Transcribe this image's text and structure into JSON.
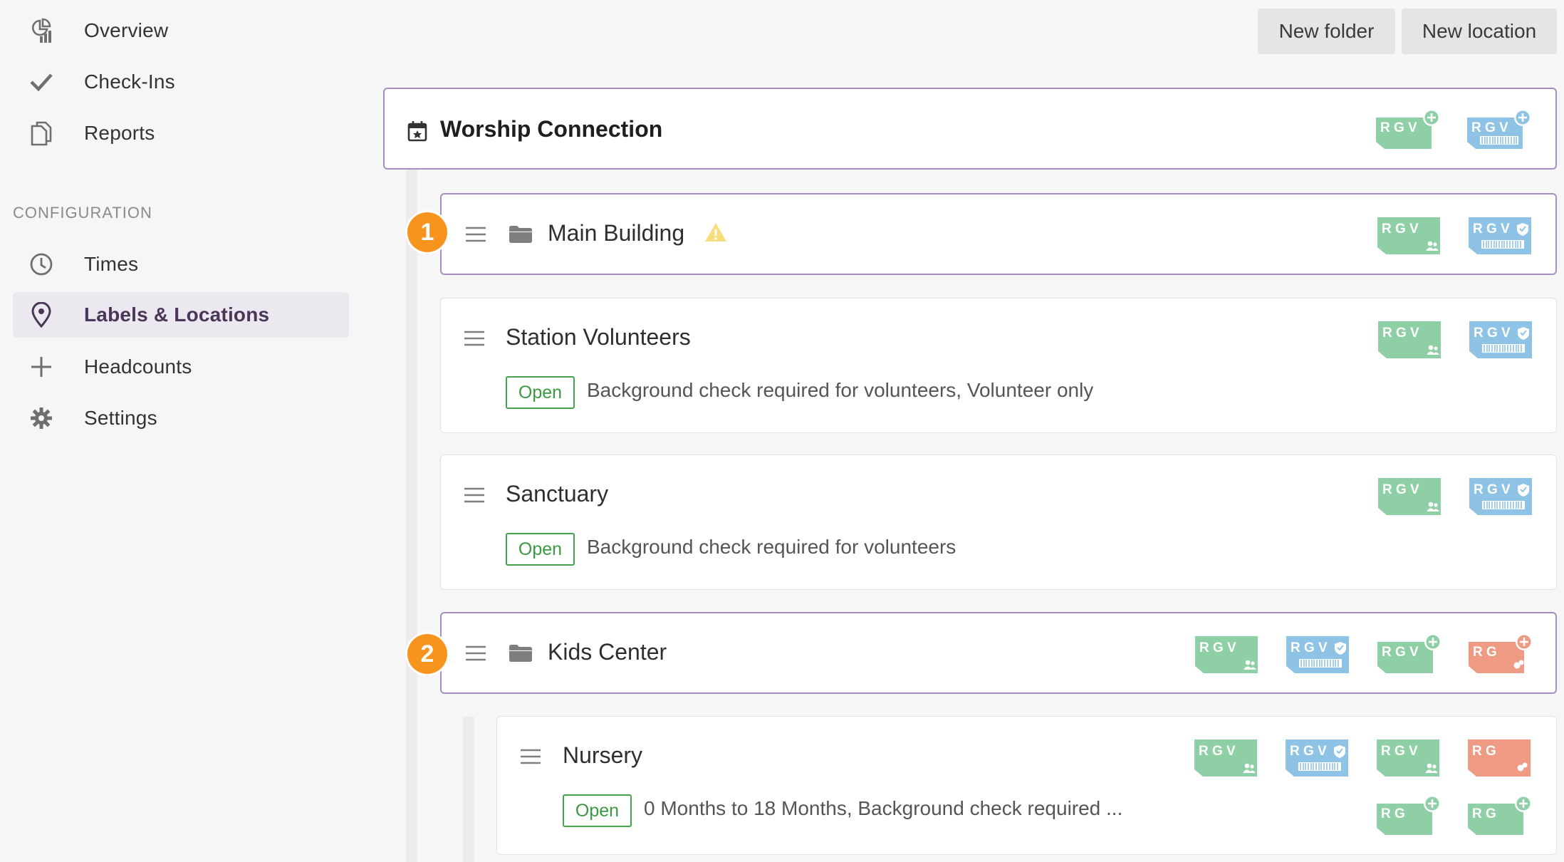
{
  "sidebar": {
    "nav": [
      {
        "label": "Overview",
        "icon": "overview-icon"
      },
      {
        "label": "Check-Ins",
        "icon": "checkmark-icon"
      },
      {
        "label": "Reports",
        "icon": "reports-icon"
      }
    ],
    "section_label": "CONFIGURATION",
    "config": [
      {
        "label": "Times",
        "icon": "clock-icon"
      },
      {
        "label": "Labels & Locations",
        "icon": "location-pin-icon",
        "active": true
      },
      {
        "label": "Headcounts",
        "icon": "plus-icon"
      },
      {
        "label": "Settings",
        "icon": "gear-icon"
      }
    ]
  },
  "toolbar": {
    "new_folder": "New folder",
    "new_location": "New location"
  },
  "tree": {
    "root": {
      "title": "Worship Connection"
    },
    "main_building": {
      "title": "Main Building",
      "marker": "1"
    },
    "station_volunteers": {
      "title": "Station Volunteers",
      "status": "Open",
      "description": "Background check required for volunteers, Volunteer only"
    },
    "sanctuary": {
      "title": "Sanctuary",
      "status": "Open",
      "description": "Background check required for volunteers"
    },
    "kids_center": {
      "title": "Kids Center",
      "marker": "2"
    },
    "nursery": {
      "title": "Nursery",
      "status": "Open",
      "description": "0 Months to 18 Months, Background check required ..."
    }
  },
  "label_text": {
    "rgv": "R G V",
    "rg": "R G"
  },
  "colors": {
    "green_label": "#8fcfa5",
    "blue_label": "#8fc3e6",
    "red_label": "#ef9a82",
    "accent_purple": "#a98cc1",
    "open_green": "#45a34a",
    "marker_orange": "#f7941d"
  }
}
